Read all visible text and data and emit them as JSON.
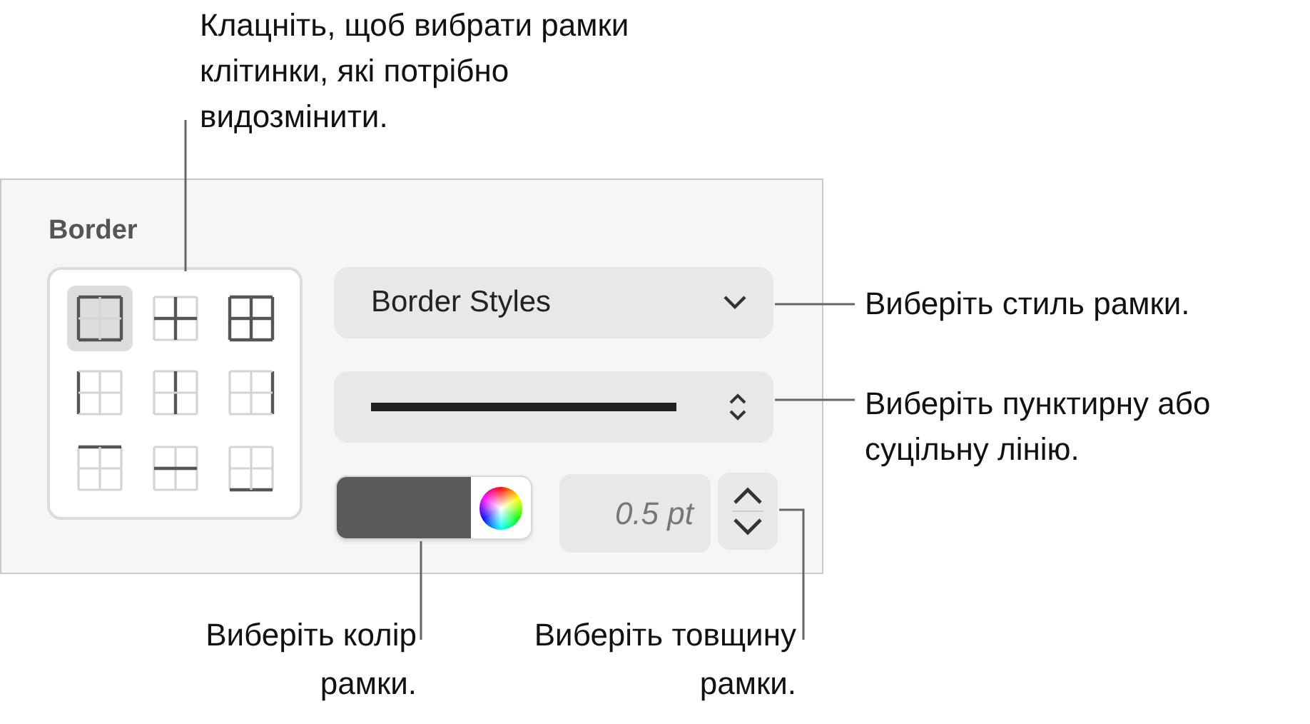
{
  "callouts": [
    {
      "kind": "top",
      "text": "Клацніть, щоб вибрати рамки клітинки, які потрібно видозмінити."
    },
    {
      "kind": "style",
      "text": "Виберіть стиль рамки."
    },
    {
      "kind": "line",
      "text": "Виберіть пунктирну або суцільну лінію."
    },
    {
      "kind": "color",
      "text": "Виберіть колір рамки."
    },
    {
      "kind": "width",
      "text": "Виберіть товщину рамки."
    }
  ],
  "panel": {
    "title": "Border",
    "border_options": [
      {
        "kind": "outer",
        "selected": true
      },
      {
        "kind": "inner",
        "selected": false
      },
      {
        "kind": "all",
        "selected": false
      },
      {
        "kind": "left",
        "selected": false
      },
      {
        "kind": "vertical",
        "selected": false
      },
      {
        "kind": "right",
        "selected": false
      },
      {
        "kind": "top",
        "selected": false
      },
      {
        "kind": "horizontal",
        "selected": false
      },
      {
        "kind": "bottom",
        "selected": false
      }
    ],
    "style_popup": "Border Styles",
    "border_color": {
      "color": "#5a5a5a"
    },
    "width_field": {
      "value": "0.5 pt"
    }
  }
}
